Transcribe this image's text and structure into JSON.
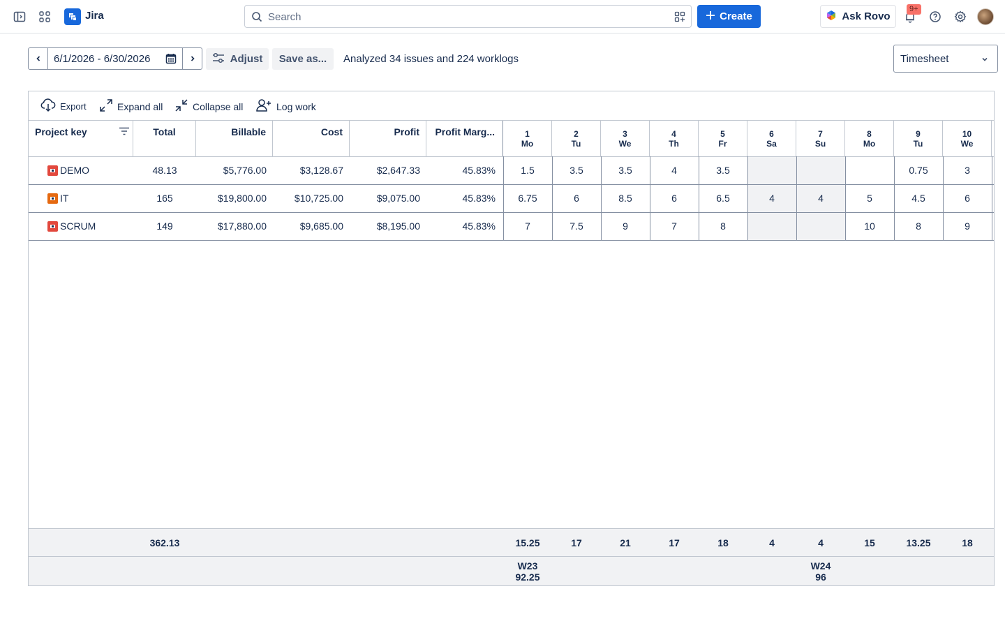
{
  "app": {
    "name": "Jira"
  },
  "search": {
    "placeholder": "Search"
  },
  "topbar": {
    "create_label": "Create",
    "ask_rovo_label": "Ask Rovo",
    "notifications_badge": "9+"
  },
  "toolbar": {
    "date_range": "6/1/2026 - 6/30/2026",
    "adjust_label": "Adjust",
    "save_as_label": "Save as...",
    "analyzed_text": "Analyzed 34 issues and 224 worklogs",
    "view_select": "Timesheet"
  },
  "panel_tools": {
    "export": "Export",
    "expand_all": "Expand all",
    "collapse_all": "Collapse all",
    "log_work": "Log work"
  },
  "columns": {
    "project_key": "Project key",
    "total": "Total",
    "billable": "Billable",
    "cost": "Cost",
    "profit": "Profit",
    "profit_margin": "Profit Marg..."
  },
  "days": [
    {
      "num": "1",
      "dow": "Mo"
    },
    {
      "num": "2",
      "dow": "Tu"
    },
    {
      "num": "3",
      "dow": "We"
    },
    {
      "num": "4",
      "dow": "Th"
    },
    {
      "num": "5",
      "dow": "Fr"
    },
    {
      "num": "6",
      "dow": "Sa"
    },
    {
      "num": "7",
      "dow": "Su"
    },
    {
      "num": "8",
      "dow": "Mo"
    },
    {
      "num": "9",
      "dow": "Tu"
    },
    {
      "num": "10",
      "dow": "We"
    }
  ],
  "rows": [
    {
      "key": "DEMO",
      "icon_color": "#e2483d",
      "total": "48.13",
      "billable": "$5,776.00",
      "cost": "$3,128.67",
      "profit": "$2,647.33",
      "margin": "45.83%",
      "days": [
        "1.5",
        "3.5",
        "3.5",
        "4",
        "3.5",
        "",
        "",
        "",
        "0.75",
        "3"
      ]
    },
    {
      "key": "IT",
      "icon_color": "#e56910",
      "total": "165",
      "billable": "$19,800.00",
      "cost": "$10,725.00",
      "profit": "$9,075.00",
      "margin": "45.83%",
      "days": [
        "6.75",
        "6",
        "8.5",
        "6",
        "6.5",
        "4",
        "4",
        "5",
        "4.5",
        "6"
      ]
    },
    {
      "key": "SCRUM",
      "icon_color": "#e2483d",
      "total": "149",
      "billable": "$17,880.00",
      "cost": "$9,685.00",
      "profit": "$8,195.00",
      "margin": "45.83%",
      "days": [
        "7",
        "7.5",
        "9",
        "7",
        "8",
        "",
        "",
        "10",
        "8",
        "9"
      ]
    }
  ],
  "totals": {
    "total": "362.13",
    "days": [
      "15.25",
      "17",
      "21",
      "17",
      "18",
      "4",
      "4",
      "15",
      "13.25",
      "18"
    ]
  },
  "weeks": [
    {
      "label": "W23",
      "value": "92.25"
    },
    {
      "label": "W24",
      "value": "96"
    }
  ]
}
